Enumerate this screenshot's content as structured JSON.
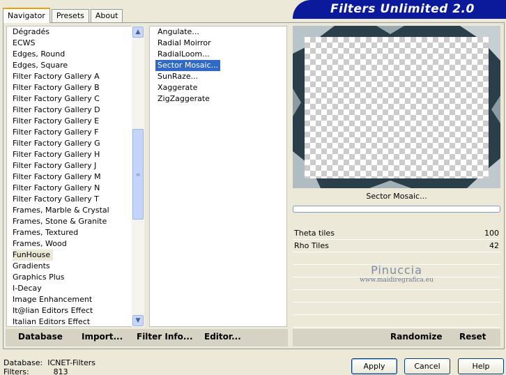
{
  "header": {
    "title": "Filters Unlimited 2.0"
  },
  "tabs": [
    {
      "label": "Navigator",
      "active": true
    },
    {
      "label": "Presets",
      "active": false
    },
    {
      "label": "About",
      "active": false
    }
  ],
  "categories": [
    "Dégradés",
    "ECWS",
    "Edges, Round",
    "Edges, Square",
    "Filter Factory Gallery A",
    "Filter Factory Gallery B",
    "Filter Factory Gallery C",
    "Filter Factory Gallery D",
    "Filter Factory Gallery E",
    "Filter Factory Gallery F",
    "Filter Factory Gallery G",
    "Filter Factory Gallery H",
    "Filter Factory Gallery J",
    "Filter Factory Gallery M",
    "Filter Factory Gallery N",
    "Filter Factory Gallery T",
    "Frames, Marble & Crystal",
    "Frames, Stone & Granite",
    "Frames, Textured",
    "Frames, Wood",
    "FunHouse",
    "Gradients",
    "Graphics Plus",
    "I-Decay",
    "Image Enhancement",
    "It@lian Editors Effect",
    "Italian Editors Effect"
  ],
  "selected_category": "FunHouse",
  "filters": [
    "Angulate...",
    "Radial Moirror",
    "RadialLoom...",
    "Sector Mosaic...",
    "SunRaze...",
    "Xaggerate",
    "ZigZaggerate"
  ],
  "selected_filter": "Sector Mosaic...",
  "preview": {
    "filter_name": "Sector Mosaic..."
  },
  "params": [
    {
      "label": "Theta tiles",
      "value": "100"
    },
    {
      "label": "Rho Tiles",
      "value": "42"
    }
  ],
  "watermark": {
    "name": "Pinuccia",
    "url": "www.maidiregrafica.eu"
  },
  "toolbar": {
    "database": "Database",
    "import": "Import...",
    "filter_info": "Filter Info...",
    "editor": "Editor...",
    "randomize": "Randomize",
    "reset": "Reset"
  },
  "footer": {
    "database_label": "Database:",
    "database_value": "ICNET-Filters",
    "filters_label": "Filters:",
    "filters_value": "813",
    "apply": "Apply",
    "cancel": "Cancel",
    "help": "Help"
  },
  "colors": {
    "banner": "#0a1a9a",
    "selection": "#316ac5",
    "frame": "#2b3f4a"
  }
}
